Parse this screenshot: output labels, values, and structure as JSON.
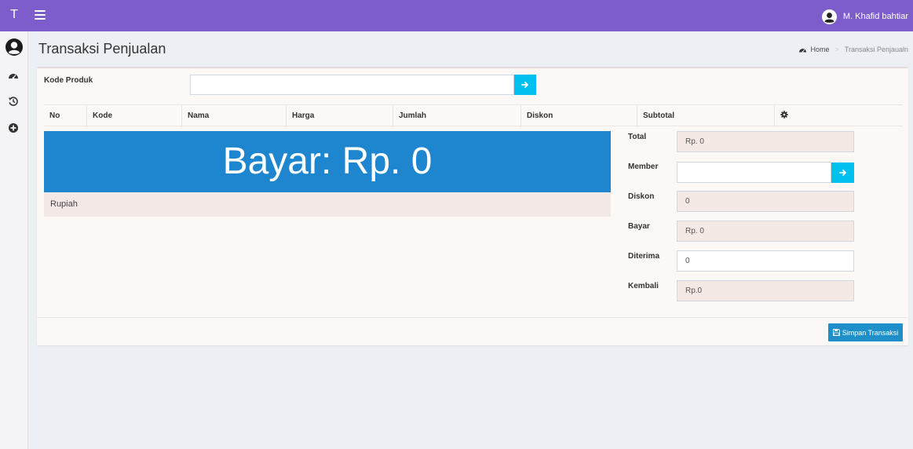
{
  "app": {
    "logo": "T",
    "user_name": "M. Khafid bahtiar"
  },
  "page": {
    "title": "Transaksi Penjualan"
  },
  "breadcrumb": {
    "home": "Home",
    "current": "Transaksi Penjaualn"
  },
  "form": {
    "kode_produk_label": "Kode Produk",
    "kode_produk_value": ""
  },
  "table": {
    "columns": [
      "No",
      "Kode",
      "Nama",
      "Harga",
      "Jumlah",
      "Diskon",
      "Subtotal"
    ],
    "action_icon": "gear-icon",
    "rows": []
  },
  "banner": {
    "text": "Bayar: Rp. 0",
    "caption": "Rupiah"
  },
  "summary": {
    "total_label": "Total",
    "total_value": "Rp. 0",
    "member_label": "Member",
    "member_value": "",
    "diskon_label": "Diskon",
    "diskon_value": "0",
    "bayar_label": "Bayar",
    "bayar_value": "Rp. 0",
    "diterima_label": "Diterima",
    "diterima_value": "0",
    "kembali_label": "Kembali",
    "kembali_value": "Rp.0"
  },
  "actions": {
    "save_label": "Simpan Transaksi"
  },
  "sidebar": {
    "icons": [
      "dashboard-icon",
      "history-icon",
      "add-circle-icon"
    ]
  },
  "colors": {
    "navbar": "#7d5ccc",
    "banner": "#1e85cf",
    "info_button": "#00c0ef",
    "save_button": "#1e8fc8"
  }
}
